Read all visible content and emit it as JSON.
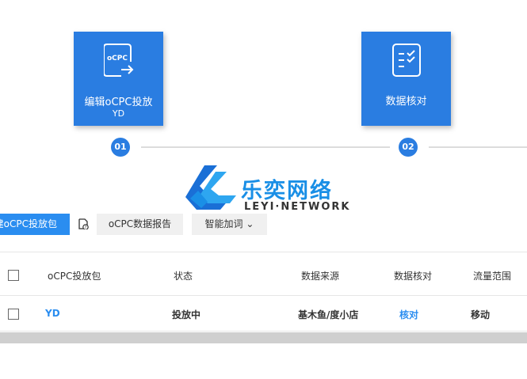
{
  "steps": [
    {
      "label": "编辑oCPC投放",
      "sublabel": "YD",
      "number": "01",
      "icon_text": "oCPC",
      "icon": "ocpc-document-icon"
    },
    {
      "label": "数据核对",
      "number": "02",
      "icon": "checklist-icon"
    }
  ],
  "watermark": {
    "cn": "乐奕网络",
    "en": "LEYI·NETWORK"
  },
  "toolbar": {
    "create_label": "建oCPC投放包",
    "report_label": "oCPC数据报告",
    "smart_bid_label": "智能加词",
    "smart_bid_caret": "⌄"
  },
  "table": {
    "headers": [
      "oCPC投放包",
      "状态",
      "数据来源",
      "数据核对",
      "流量范围"
    ],
    "rows": [
      {
        "name": "YD",
        "status": "投放中",
        "source": "基木鱼/度小店",
        "check": "核对",
        "range": "移动"
      }
    ]
  },
  "colors": {
    "accent": "#2a7de1",
    "link": "#2a8df0"
  }
}
